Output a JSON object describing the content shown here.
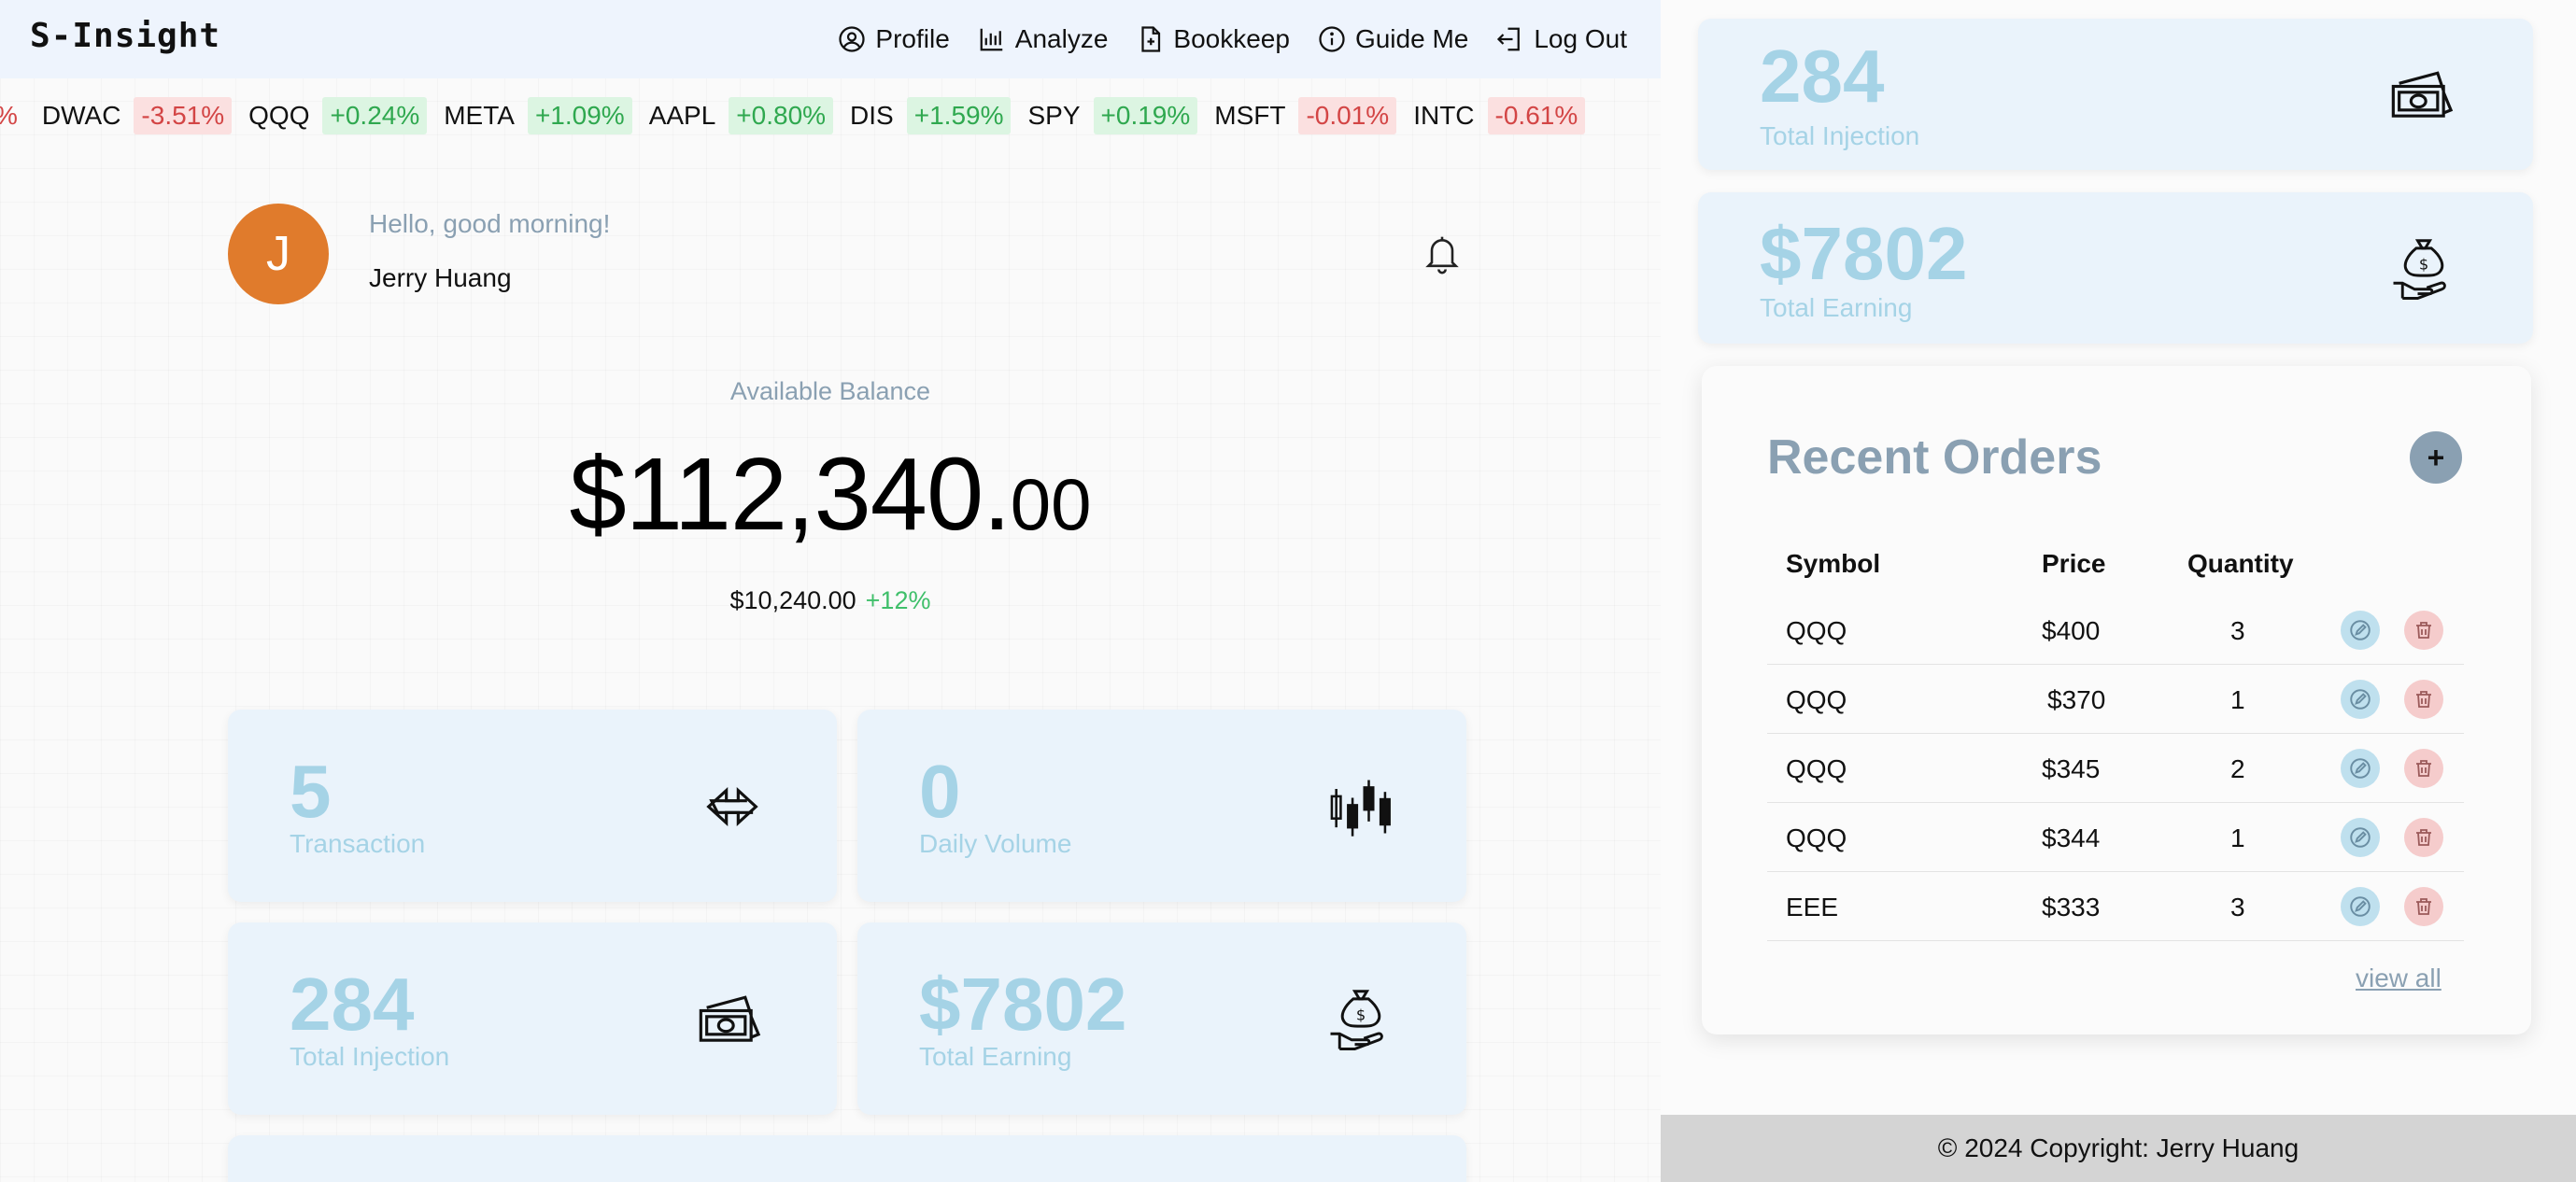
{
  "app": {
    "brand": "S-Insight"
  },
  "nav": {
    "items": [
      {
        "label": "Profile",
        "icon": "user-circle-icon"
      },
      {
        "label": "Analyze",
        "icon": "bar-chart-icon"
      },
      {
        "label": "Bookkeep",
        "icon": "document-icon"
      },
      {
        "label": "Guide Me",
        "icon": "info-icon"
      },
      {
        "label": "Log Out",
        "icon": "logout-icon"
      }
    ]
  },
  "ticker": [
    {
      "symbol": "",
      "change": "%",
      "dir": "down"
    },
    {
      "symbol": "DWAC",
      "change": "-3.51%",
      "dir": "down"
    },
    {
      "symbol": "QQQ",
      "change": "+0.24%",
      "dir": "up"
    },
    {
      "symbol": "META",
      "change": "+1.09%",
      "dir": "up"
    },
    {
      "symbol": "AAPL",
      "change": "+0.80%",
      "dir": "up"
    },
    {
      "symbol": "DIS",
      "change": "+1.59%",
      "dir": "up"
    },
    {
      "symbol": "SPY",
      "change": "+0.19%",
      "dir": "up"
    },
    {
      "symbol": "MSFT",
      "change": "-0.01%",
      "dir": "down"
    },
    {
      "symbol": "INTC",
      "change": "-0.61%",
      "dir": "down"
    }
  ],
  "user": {
    "initial": "J",
    "greeting": "Hello, good morning!",
    "name": "Jerry Huang"
  },
  "balance": {
    "label": "Available Balance",
    "main": "$112,340.",
    "cents": "00",
    "change_amount": "$10,240.00",
    "change_pct": "+12%"
  },
  "stats": {
    "transaction": {
      "value": "5",
      "label": "Transaction",
      "icon": "exchange-icon"
    },
    "daily_volume": {
      "value": "0",
      "label": "Daily Volume",
      "icon": "candlestick-icon"
    },
    "total_injection": {
      "value": "284",
      "label": "Total Injection",
      "icon": "money-icon"
    },
    "total_earning": {
      "value": "$7802",
      "label": "Total Earning",
      "icon": "money-bag-hand-icon"
    }
  },
  "orders": {
    "title": "Recent Orders",
    "add_label": "+",
    "columns": [
      "Symbol",
      "Price",
      "Quantity"
    ],
    "rows": [
      {
        "symbol": "QQQ",
        "price": "$400",
        "quantity": "3"
      },
      {
        "symbol": "QQQ",
        "price": "$370",
        "quantity": "1"
      },
      {
        "symbol": "QQQ",
        "price": "$345",
        "quantity": "2"
      },
      {
        "symbol": "QQQ",
        "price": "$344",
        "quantity": "1"
      },
      {
        "symbol": "EEE",
        "price": "$333",
        "quantity": "3"
      }
    ],
    "view_all": "view all"
  },
  "footer": {
    "text": "© 2024 Copyright: Jerry Huang"
  },
  "colors": {
    "nav_bg": "#eef4fd",
    "card_bg": "#eaf3fb",
    "card_text": "#a5d3e6",
    "muted": "#8aa0b2",
    "avatar": "#e07b2c",
    "up": "#2fa84f",
    "down": "#d34545"
  }
}
